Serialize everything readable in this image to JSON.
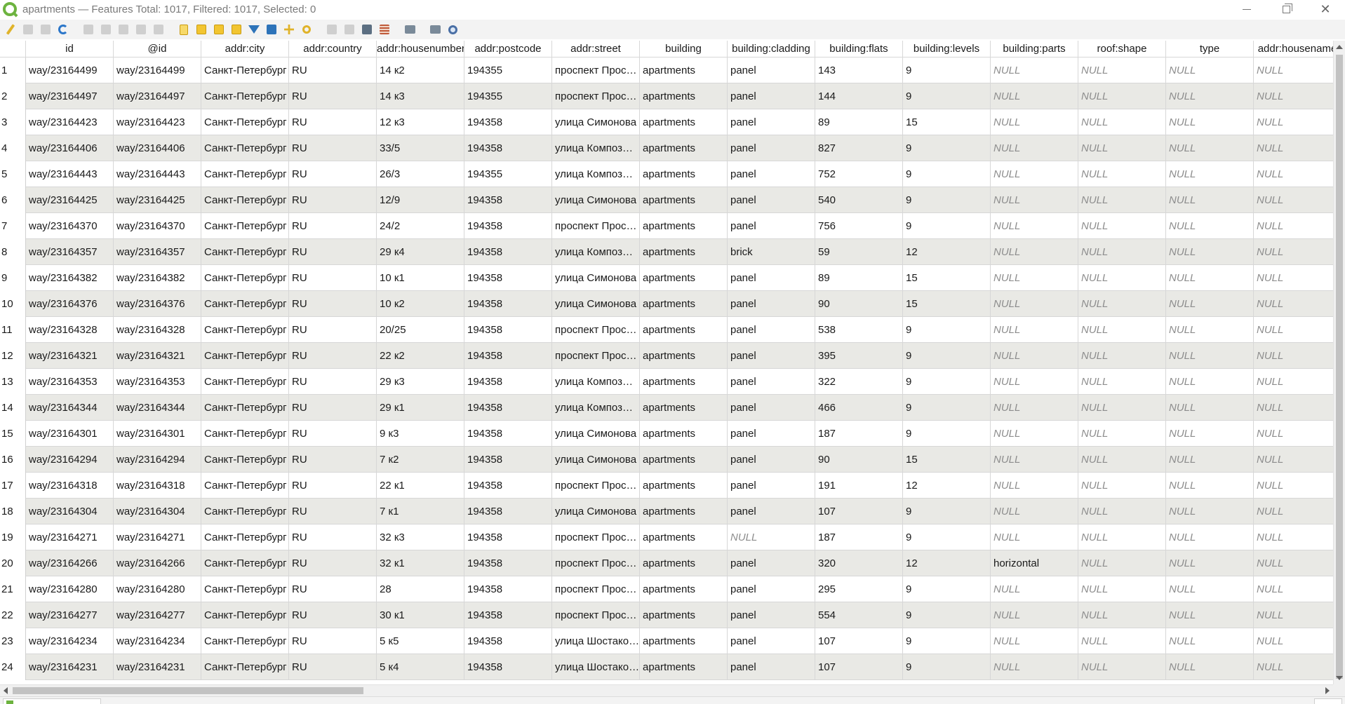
{
  "window": {
    "title": "apartments — Features Total: 1017, Filtered: 1017, Selected: 0"
  },
  "toolbar": {
    "buttons": [
      "pencil-icon",
      "multi-edit-icon",
      "save-icon",
      "refresh-icon",
      "add-feature-icon",
      "delete-icon",
      "cut-icon",
      "copy-icon",
      "paste-icon",
      "expression-select-icon",
      "select-all-icon",
      "invert-selection-icon",
      "deselect-icon",
      "filter-selected-icon",
      "move-selection-top-icon",
      "pan-to-selected-icon",
      "zoom-to-selected-icon",
      "new-field-icon",
      "delete-field-icon",
      "field-calculator-icon",
      "conditional-format-icon",
      "dock-icon",
      "actions-icon"
    ]
  },
  "table": {
    "columns": [
      "id",
      "@id",
      "addr:city",
      "addr:country",
      "addr:housenumber",
      "addr:postcode",
      "addr:street",
      "building",
      "building:cladding",
      "building:flats",
      "building:levels",
      "building:parts",
      "roof:shape",
      "type",
      "addr:housename"
    ],
    "rows": [
      {
        "n": "1",
        "cells": [
          "way/23164499",
          "way/23164499",
          "Санкт-Петербург",
          "RU",
          "14 к2",
          "194355",
          "проспект Прос…",
          "apartments",
          "panel",
          "143",
          "9",
          "NULL",
          "NULL",
          "NULL",
          "NULL"
        ]
      },
      {
        "n": "2",
        "cells": [
          "way/23164497",
          "way/23164497",
          "Санкт-Петербург",
          "RU",
          "14 к3",
          "194355",
          "проспект Прос…",
          "apartments",
          "panel",
          "144",
          "9",
          "NULL",
          "NULL",
          "NULL",
          "NULL"
        ]
      },
      {
        "n": "3",
        "cells": [
          "way/23164423",
          "way/23164423",
          "Санкт-Петербург",
          "RU",
          "12 к3",
          "194358",
          "улица Симонова",
          "apartments",
          "panel",
          "89",
          "15",
          "NULL",
          "NULL",
          "NULL",
          "NULL"
        ]
      },
      {
        "n": "4",
        "cells": [
          "way/23164406",
          "way/23164406",
          "Санкт-Петербург",
          "RU",
          "33/5",
          "194358",
          "улица Композ…",
          "apartments",
          "panel",
          "827",
          "9",
          "NULL",
          "NULL",
          "NULL",
          "NULL"
        ]
      },
      {
        "n": "5",
        "cells": [
          "way/23164443",
          "way/23164443",
          "Санкт-Петербург",
          "RU",
          "26/3",
          "194355",
          "улица Композ…",
          "apartments",
          "panel",
          "752",
          "9",
          "NULL",
          "NULL",
          "NULL",
          "NULL"
        ]
      },
      {
        "n": "6",
        "cells": [
          "way/23164425",
          "way/23164425",
          "Санкт-Петербург",
          "RU",
          "12/9",
          "194358",
          "улица Симонова",
          "apartments",
          "panel",
          "540",
          "9",
          "NULL",
          "NULL",
          "NULL",
          "NULL"
        ]
      },
      {
        "n": "7",
        "cells": [
          "way/23164370",
          "way/23164370",
          "Санкт-Петербург",
          "RU",
          "24/2",
          "194358",
          "проспект Прос…",
          "apartments",
          "panel",
          "756",
          "9",
          "NULL",
          "NULL",
          "NULL",
          "NULL"
        ]
      },
      {
        "n": "8",
        "cells": [
          "way/23164357",
          "way/23164357",
          "Санкт-Петербург",
          "RU",
          "29 к4",
          "194358",
          "улица Композ…",
          "apartments",
          "brick",
          "59",
          "12",
          "NULL",
          "NULL",
          "NULL",
          "NULL"
        ]
      },
      {
        "n": "9",
        "cells": [
          "way/23164382",
          "way/23164382",
          "Санкт-Петербург",
          "RU",
          "10 к1",
          "194358",
          "улица Симонова",
          "apartments",
          "panel",
          "89",
          "15",
          "NULL",
          "NULL",
          "NULL",
          "NULL"
        ]
      },
      {
        "n": "10",
        "cells": [
          "way/23164376",
          "way/23164376",
          "Санкт-Петербург",
          "RU",
          "10 к2",
          "194358",
          "улица Симонова",
          "apartments",
          "panel",
          "90",
          "15",
          "NULL",
          "NULL",
          "NULL",
          "NULL"
        ]
      },
      {
        "n": "11",
        "cells": [
          "way/23164328",
          "way/23164328",
          "Санкт-Петербург",
          "RU",
          "20/25",
          "194358",
          "проспект Прос…",
          "apartments",
          "panel",
          "538",
          "9",
          "NULL",
          "NULL",
          "NULL",
          "NULL"
        ]
      },
      {
        "n": "12",
        "cells": [
          "way/23164321",
          "way/23164321",
          "Санкт-Петербург",
          "RU",
          "22 к2",
          "194358",
          "проспект Прос…",
          "apartments",
          "panel",
          "395",
          "9",
          "NULL",
          "NULL",
          "NULL",
          "NULL"
        ]
      },
      {
        "n": "13",
        "cells": [
          "way/23164353",
          "way/23164353",
          "Санкт-Петербург",
          "RU",
          "29 к3",
          "194358",
          "улица Композ…",
          "apartments",
          "panel",
          "322",
          "9",
          "NULL",
          "NULL",
          "NULL",
          "NULL"
        ]
      },
      {
        "n": "14",
        "cells": [
          "way/23164344",
          "way/23164344",
          "Санкт-Петербург",
          "RU",
          "29 к1",
          "194358",
          "улица Композ…",
          "apartments",
          "panel",
          "466",
          "9",
          "NULL",
          "NULL",
          "NULL",
          "NULL"
        ]
      },
      {
        "n": "15",
        "cells": [
          "way/23164301",
          "way/23164301",
          "Санкт-Петербург",
          "RU",
          "9 к3",
          "194358",
          "улица Симонова",
          "apartments",
          "panel",
          "187",
          "9",
          "NULL",
          "NULL",
          "NULL",
          "NULL"
        ]
      },
      {
        "n": "16",
        "cells": [
          "way/23164294",
          "way/23164294",
          "Санкт-Петербург",
          "RU",
          "7 к2",
          "194358",
          "улица Симонова",
          "apartments",
          "panel",
          "90",
          "15",
          "NULL",
          "NULL",
          "NULL",
          "NULL"
        ]
      },
      {
        "n": "17",
        "cells": [
          "way/23164318",
          "way/23164318",
          "Санкт-Петербург",
          "RU",
          "22 к1",
          "194358",
          "проспект Прос…",
          "apartments",
          "panel",
          "191",
          "12",
          "NULL",
          "NULL",
          "NULL",
          "NULL"
        ]
      },
      {
        "n": "18",
        "cells": [
          "way/23164304",
          "way/23164304",
          "Санкт-Петербург",
          "RU",
          "7 к1",
          "194358",
          "улица Симонова",
          "apartments",
          "panel",
          "107",
          "9",
          "NULL",
          "NULL",
          "NULL",
          "NULL"
        ]
      },
      {
        "n": "19",
        "cells": [
          "way/23164271",
          "way/23164271",
          "Санкт-Петербург",
          "RU",
          "32 к3",
          "194358",
          "проспект Прос…",
          "apartments",
          "NULL",
          "187",
          "9",
          "NULL",
          "NULL",
          "NULL",
          "NULL"
        ]
      },
      {
        "n": "20",
        "cells": [
          "way/23164266",
          "way/23164266",
          "Санкт-Петербург",
          "RU",
          "32 к1",
          "194358",
          "проспект Прос…",
          "apartments",
          "panel",
          "320",
          "12",
          "horizontal",
          "NULL",
          "NULL",
          "NULL"
        ]
      },
      {
        "n": "21",
        "cells": [
          "way/23164280",
          "way/23164280",
          "Санкт-Петербург",
          "RU",
          "28",
          "194358",
          "проспект Прос…",
          "apartments",
          "panel",
          "295",
          "9",
          "NULL",
          "NULL",
          "NULL",
          "NULL"
        ]
      },
      {
        "n": "22",
        "cells": [
          "way/23164277",
          "way/23164277",
          "Санкт-Петербург",
          "RU",
          "30 к1",
          "194358",
          "проспект Прос…",
          "apartments",
          "panel",
          "554",
          "9",
          "NULL",
          "NULL",
          "NULL",
          "NULL"
        ]
      },
      {
        "n": "23",
        "cells": [
          "way/23164234",
          "way/23164234",
          "Санкт-Петербург",
          "RU",
          "5 к5",
          "194358",
          "улица Шостако…",
          "apartments",
          "panel",
          "107",
          "9",
          "NULL",
          "NULL",
          "NULL",
          "NULL"
        ]
      },
      {
        "n": "24",
        "cells": [
          "way/23164231",
          "way/23164231",
          "Санкт-Петербург",
          "RU",
          "5 к4",
          "194358",
          "улица Шостако…",
          "apartments",
          "panel",
          "107",
          "9",
          "NULL",
          "NULL",
          "NULL",
          "NULL"
        ]
      }
    ]
  },
  "colors": {
    "alt_row": "#e9e9e5",
    "null_text": "#8d8d8d",
    "logo": "#6db33f"
  }
}
